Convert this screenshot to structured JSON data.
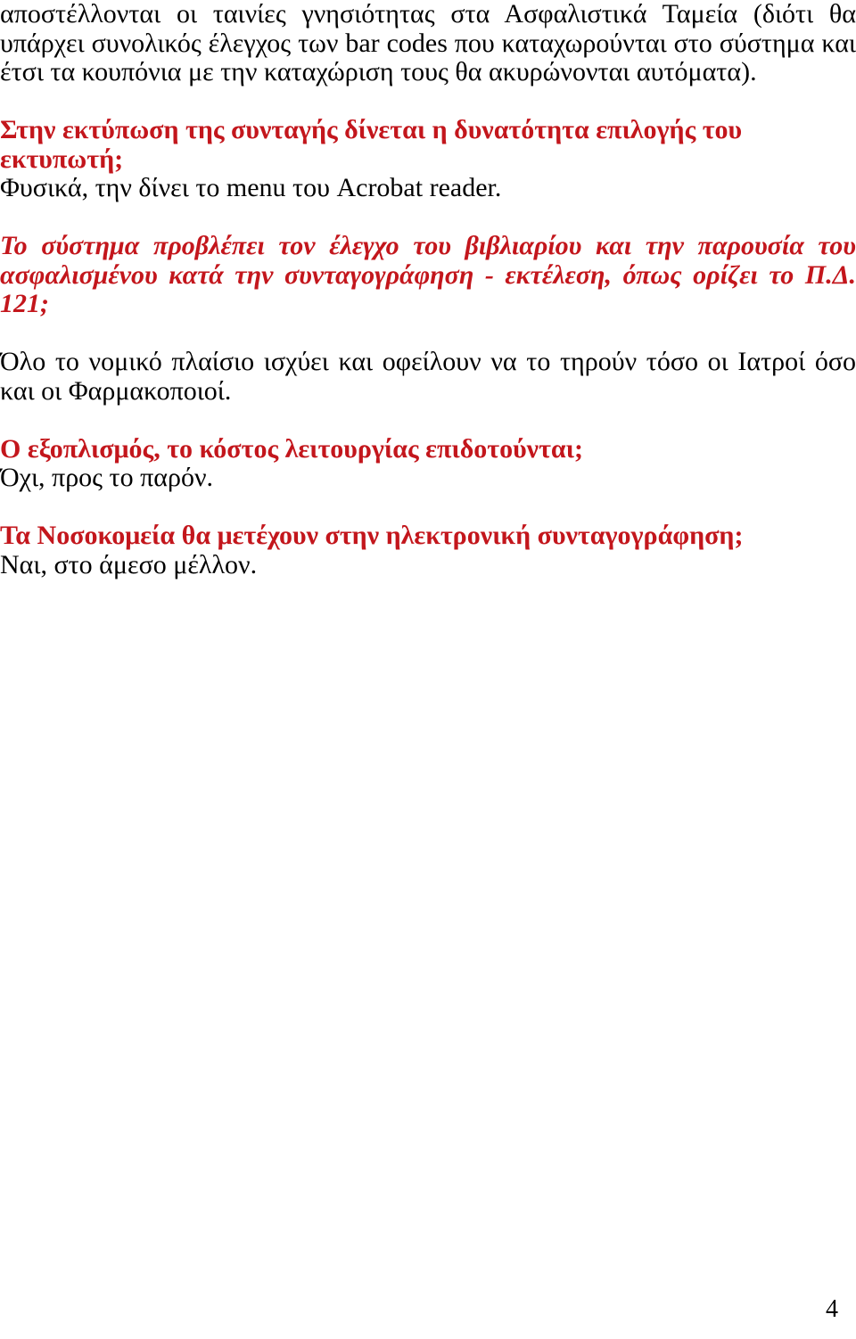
{
  "document": {
    "page_number": "4",
    "colors": {
      "text": "#000000",
      "accent_red": "#C3161C",
      "background": "#ffffff"
    },
    "blocks": {
      "intro_paragraph": "αποστέλλονται οι ταινίες γνησιότητας στα Ασφαλιστικά Ταμεία (διότι θα υπάρχει συνολικός έλεγχος των bar codes που καταχωρούνται στο σύστημα και έτσι τα κουπόνια με την καταχώριση τους θα ακυρώνονται αυτόματα).",
      "question_1": "Στην εκτύπωση της συνταγής δίνεται η δυνατότητα επιλογής του εκτυπωτή;",
      "answer_1": "Φυσικά, την δίνει το menu του Acrobat reader.",
      "question_2": "Το σύστημα προβλέπει τον έλεγχο του βιβλιαρίου και την παρουσία του ασφαλισμένου κατά την συνταγογράφηση  - εκτέλεση, όπως ορίζει το Π.Δ. 121;",
      "answer_2": "Όλο το νομικό πλαίσιο ισχύει και οφείλουν να το τηρούν τόσο οι Ιατροί όσο και οι Φαρμακοποιοί.",
      "question_3": "Ο εξοπλισμός, το κόστος λειτουργίας επιδοτούνται;",
      "answer_3": "Όχι, προς το παρόν.",
      "question_4": "Τα Νοσοκομεία θα μετέχουν στην ηλεκτρονική συνταγογράφηση;",
      "answer_4": "Ναι, στο άμεσο μέλλον."
    }
  }
}
